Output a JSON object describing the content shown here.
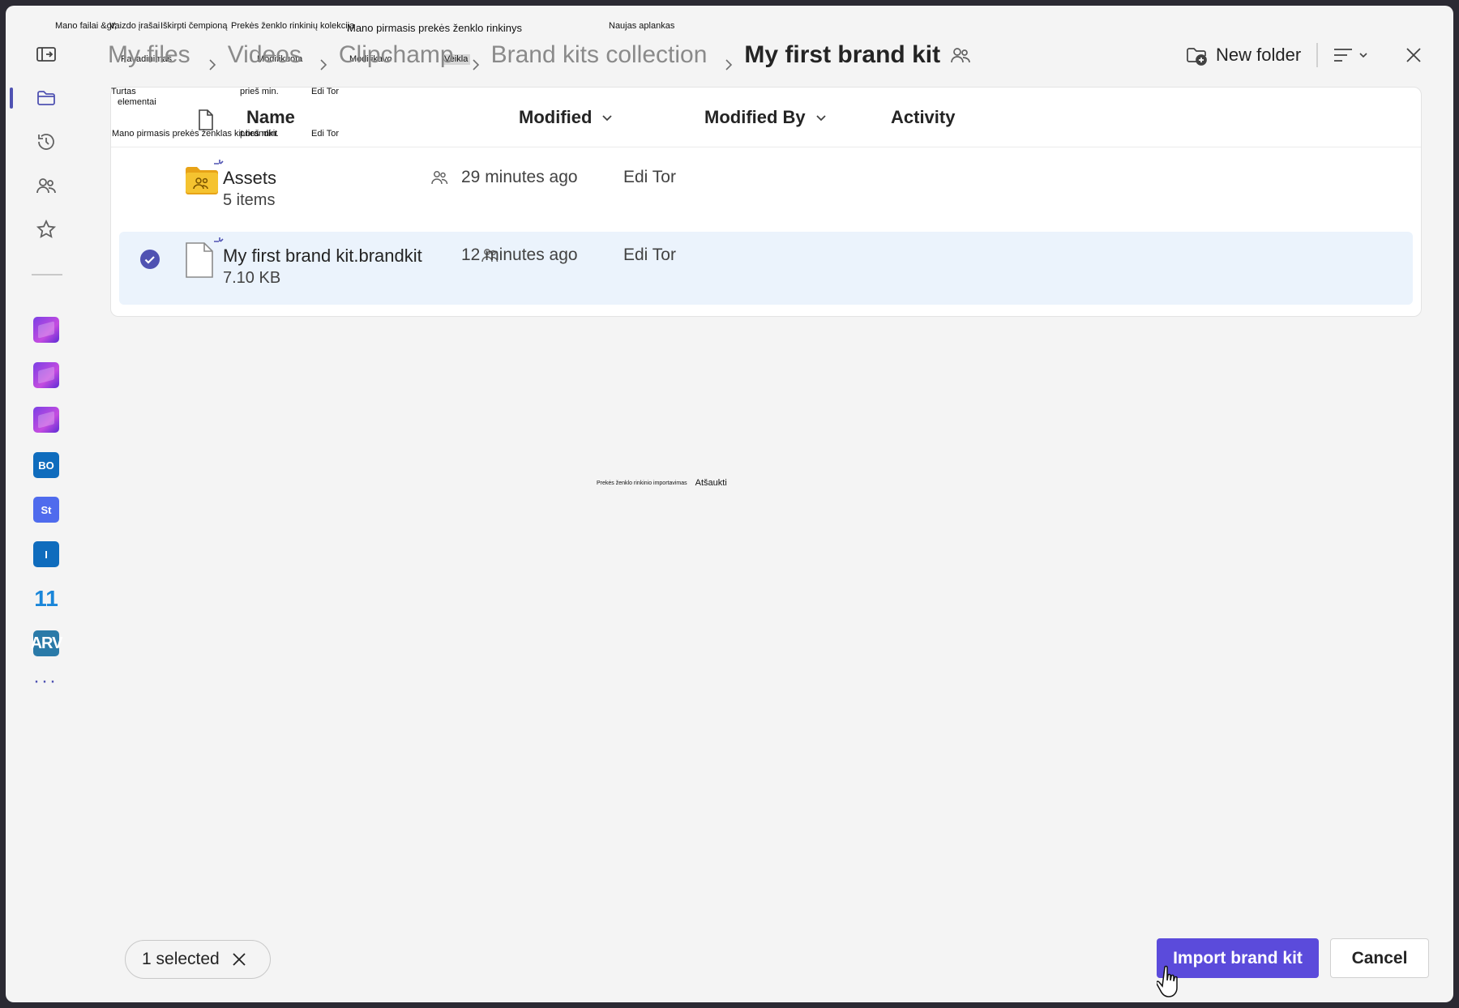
{
  "breadcrumb": {
    "items": [
      "My files",
      "Videos",
      "Clipchamp",
      "Brand kits collection"
    ],
    "current": "My first brand kit"
  },
  "header": {
    "new_folder_label": "New folder"
  },
  "overlay_labels": {
    "my_files_gt": "Mano failai &gt;",
    "videos": "Vaizdo įrašai",
    "clipchamp": "Iškirpti čempioną",
    "brand_kits": "Prekės ženklo rinkinių kolekcija",
    "current": "Mano pirmasis prekės ženklo rinkinys",
    "new_folder": "Naujas aplankas",
    "name": "Pavadinimas",
    "modified": "Modifikuota",
    "modified_by": "Modifikavo",
    "activity": "Veikla",
    "assets": "Turtas",
    "items": "elementai",
    "minutes_ago_1": "prieš min.",
    "edi_tor_1": "Edi Tor",
    "brandkit_name": "Mano pirmasis prekės ženklas kit.brandkit",
    "minutes_ago_2": "prieš min.",
    "edi_tor_2": "Edi Tor",
    "import_brand_kit": "Prekės ženklo rinkinio importavimas",
    "cancel": "Atšaukti"
  },
  "table": {
    "columns": {
      "name": "Name",
      "modified": "Modified",
      "modified_by": "Modified By",
      "activity": "Activity"
    },
    "rows": [
      {
        "name": "Assets",
        "sub": "5 items",
        "modified": "29 minutes ago",
        "modified_by": "Edi Tor",
        "type": "shared-folder-icon",
        "selected": false
      },
      {
        "name": "My first brand kit.brandkit",
        "sub": "7.10 KB",
        "modified": "12 minutes ago",
        "modified_by": "Edi Tor",
        "type": "file-icon",
        "selected": true
      }
    ]
  },
  "rail": {
    "apps": [
      {
        "label": "",
        "icon": "clipchamp-icon"
      },
      {
        "label": "",
        "icon": "clipchamp-icon"
      },
      {
        "label": "",
        "icon": "clipchamp-icon"
      },
      {
        "label": "BO",
        "icon": "bo-app-icon"
      },
      {
        "label": "St",
        "icon": "st-app-icon"
      },
      {
        "label": "I",
        "icon": "i-app-icon"
      },
      {
        "label": "11",
        "icon": "windows11-icon"
      },
      {
        "label": "ARV",
        "icon": "arv-app-icon"
      }
    ],
    "more": "···"
  },
  "footer": {
    "selected_label": "1 selected",
    "import_label": "Import brand kit",
    "cancel_label": "Cancel"
  },
  "colors": {
    "accent": "#5b4bdb",
    "selected_row": "#ebf3fc",
    "rail_accent": "#4f52b2",
    "folder": "#f5c330"
  }
}
